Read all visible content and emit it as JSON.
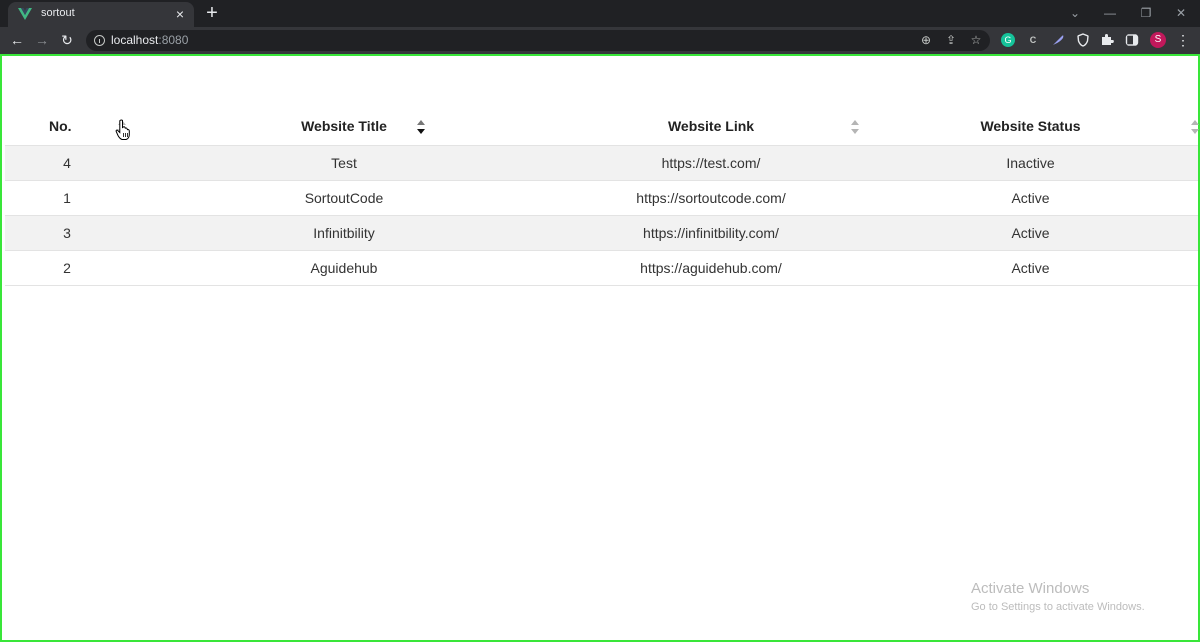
{
  "browser": {
    "tab_title": "sortout",
    "tab_close": "×",
    "new_tab": "+",
    "window_controls": {
      "minimize": "—",
      "restore": "❐",
      "close": "✕",
      "tab_search": "⌄"
    },
    "nav": {
      "back": "←",
      "forward": "→",
      "reload": "↻"
    },
    "url_host": "localhost",
    "url_port": ":8080",
    "omnibox_icons": {
      "zoom": "⊕",
      "share": "⇪",
      "bookmark": "☆"
    },
    "extensions": [
      "grammarly-icon",
      "extension-c-icon",
      "feather-icon",
      "shield-icon",
      "puzzle-icon",
      "sidebar-icon"
    ],
    "profile_initial": "S",
    "menu": "⋮",
    "colors": {
      "frame": "#202124",
      "toolbar": "#35363a",
      "viewport_border": "#39e639",
      "profile": "#c2185b"
    }
  },
  "table": {
    "columns": [
      {
        "label": "No.",
        "sort_state": "none"
      },
      {
        "label": "Website Title",
        "sort_state": "descending"
      },
      {
        "label": "Website Link",
        "sort_state": "none"
      },
      {
        "label": "Website Status",
        "sort_state": "none"
      }
    ],
    "rows": [
      {
        "no": "4",
        "title": "Test",
        "link": "https://test.com/",
        "status": "Inactive"
      },
      {
        "no": "1",
        "title": "SortoutCode",
        "link": "https://sortoutcode.com/",
        "status": "Active"
      },
      {
        "no": "3",
        "title": "Infinitbility",
        "link": "https://infinitbility.com/",
        "status": "Active"
      },
      {
        "no": "2",
        "title": "Aguidehub",
        "link": "https://aguidehub.com/",
        "status": "Active"
      }
    ]
  },
  "watermark": {
    "title": "Activate Windows",
    "subtitle": "Go to Settings to activate Windows."
  },
  "cursor": "hand-pointer-icon"
}
